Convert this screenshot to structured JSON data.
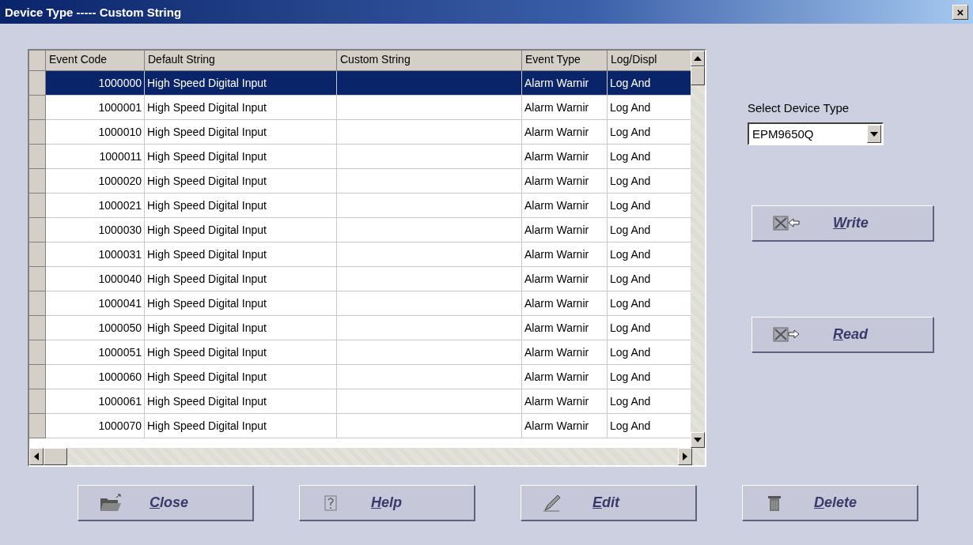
{
  "window": {
    "title": "Device Type ----- Custom String",
    "close": "×"
  },
  "table": {
    "columns": [
      "Event Code",
      "Default String",
      "Custom String",
      "Event Type",
      "Log/Displ"
    ],
    "rows": [
      {
        "selected": true,
        "cells": [
          "1000000",
          "High Speed Digital Input",
          "",
          "Alarm Warnir",
          "Log And"
        ]
      },
      {
        "selected": false,
        "cells": [
          "1000001",
          "High Speed Digital Input",
          "",
          "Alarm Warnir",
          "Log And"
        ]
      },
      {
        "selected": false,
        "cells": [
          "1000010",
          "High Speed Digital Input",
          "",
          "Alarm Warnir",
          "Log And"
        ]
      },
      {
        "selected": false,
        "cells": [
          "1000011",
          "High Speed Digital Input",
          "",
          "Alarm Warnir",
          "Log And"
        ]
      },
      {
        "selected": false,
        "cells": [
          "1000020",
          "High Speed Digital Input",
          "",
          "Alarm Warnir",
          "Log And"
        ]
      },
      {
        "selected": false,
        "cells": [
          "1000021",
          "High Speed Digital Input",
          "",
          "Alarm Warnir",
          "Log And"
        ]
      },
      {
        "selected": false,
        "cells": [
          "1000030",
          "High Speed Digital Input",
          "",
          "Alarm Warnir",
          "Log And"
        ]
      },
      {
        "selected": false,
        "cells": [
          "1000031",
          "High Speed Digital Input",
          "",
          "Alarm Warnir",
          "Log And"
        ]
      },
      {
        "selected": false,
        "cells": [
          "1000040",
          "High Speed Digital Input",
          "",
          "Alarm Warnir",
          "Log And"
        ]
      },
      {
        "selected": false,
        "cells": [
          "1000041",
          "High Speed Digital Input",
          "",
          "Alarm Warnir",
          "Log And"
        ]
      },
      {
        "selected": false,
        "cells": [
          "1000050",
          "High Speed Digital Input",
          "",
          "Alarm Warnir",
          "Log And"
        ]
      },
      {
        "selected": false,
        "cells": [
          "1000051",
          "High Speed Digital Input",
          "",
          "Alarm Warnir",
          "Log And"
        ]
      },
      {
        "selected": false,
        "cells": [
          "1000060",
          "High Speed Digital Input",
          "",
          "Alarm Warnir",
          "Log And"
        ]
      },
      {
        "selected": false,
        "cells": [
          "1000061",
          "High Speed Digital Input",
          "",
          "Alarm Warnir",
          "Log And"
        ]
      },
      {
        "selected": false,
        "cells": [
          "1000070",
          "High Speed Digital Input",
          "",
          "Alarm Warnir",
          "Log And"
        ]
      }
    ]
  },
  "device_type": {
    "label": "Select Device Type",
    "value": "EPM9650Q"
  },
  "side_buttons": [
    {
      "kind": "write",
      "label": "Write"
    },
    {
      "kind": "read",
      "label": "Read"
    }
  ],
  "bottom_buttons": [
    {
      "kind": "close",
      "label": "Close"
    },
    {
      "kind": "help",
      "label": "Help"
    },
    {
      "kind": "edit",
      "label": "Edit"
    },
    {
      "kind": "delete",
      "label": "Delete"
    }
  ]
}
